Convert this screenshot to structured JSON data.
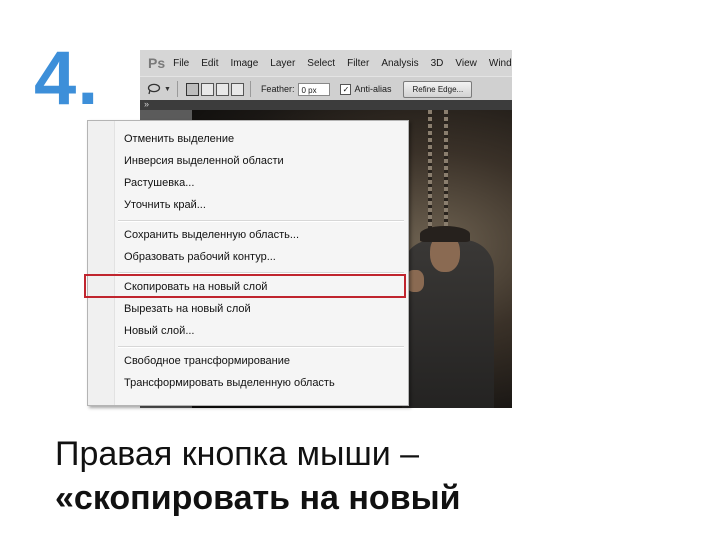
{
  "slide": {
    "step_number": "4.",
    "caption_line1": "Правая кнопка мыши –",
    "caption_line2": "«скопировать на новый"
  },
  "photoshop": {
    "logo": "Ps",
    "menu": [
      "File",
      "Edit",
      "Image",
      "Layer",
      "Select",
      "Filter",
      "Analysis",
      "3D",
      "View",
      "Window"
    ],
    "options_bar": {
      "feather_label": "Feather:",
      "feather_value": "0 px",
      "anti_alias_label": "Anti-alias",
      "anti_alias_checked": true,
      "refine_edge_label": "Refine Edge..."
    },
    "collapse_glyph": "»"
  },
  "context_menu": {
    "groups": [
      [
        "Отменить выделение",
        "Инверсия выделенной области",
        "Растушевка...",
        "Уточнить край..."
      ],
      [
        "Сохранить выделенную область...",
        "Образовать рабочий контур..."
      ],
      [
        "Скопировать на новый слой",
        "Вырезать на новый слой",
        "Новый слой..."
      ],
      [
        "Свободное трансформирование",
        "Трансформировать выделенную область"
      ]
    ],
    "highlighted_item": "Скопировать на новый слой"
  },
  "colors": {
    "step_number": "#3d8fd9",
    "highlight_frame": "#c0252e",
    "menu_background": "#f5f5f5"
  },
  "icons": {
    "lasso_tool": "lasso-icon",
    "selection_modes": "selection-mode-icons",
    "collapse": "collapse-panels-icon"
  }
}
